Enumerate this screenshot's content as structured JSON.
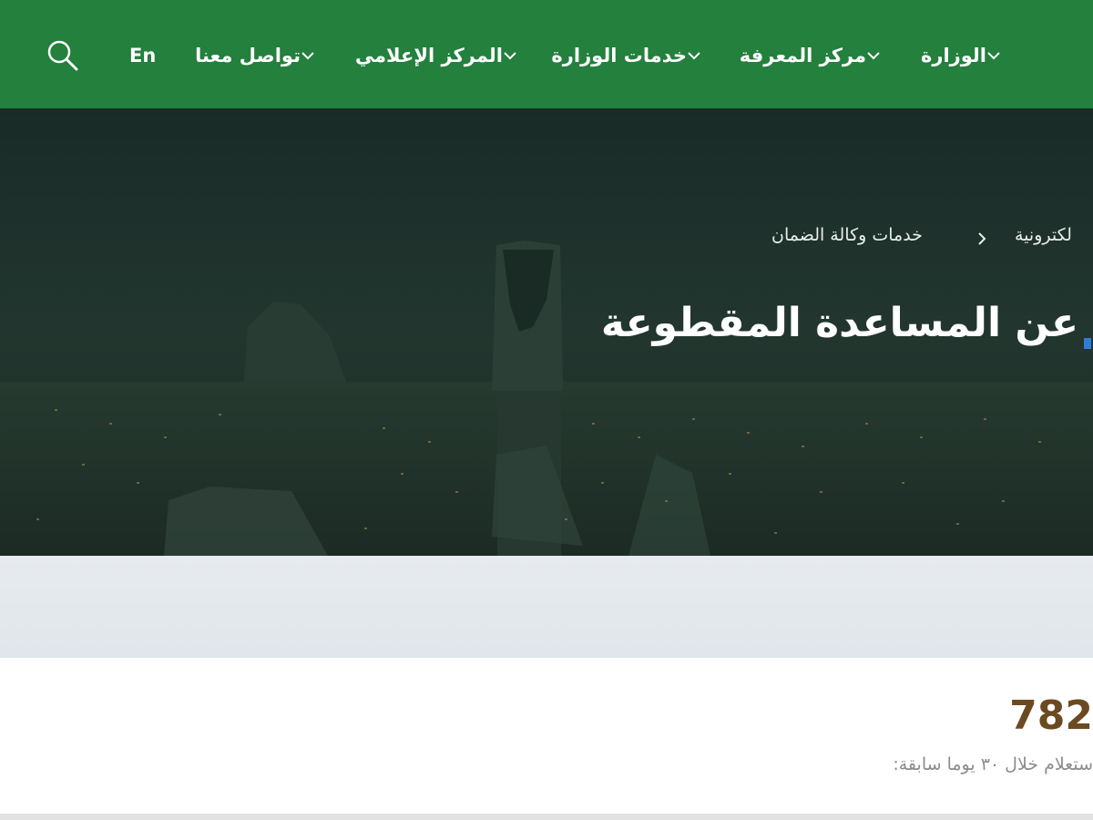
{
  "nav": {
    "items": [
      {
        "label": "الوزارة"
      },
      {
        "label": "مركز المعرفة"
      },
      {
        "label": "خدمات الوزارة"
      },
      {
        "label": "المركز الإعلامي"
      },
      {
        "label": "تواصل معنا"
      }
    ],
    "lang_label": "En",
    "search_icon": "search-icon"
  },
  "breadcrumb": {
    "first": "لكترونية",
    "second": "خدمات وكالة الضمان"
  },
  "hero": {
    "title": "عن المساعدة المقطوعة"
  },
  "stats": {
    "number": "782",
    "description": "ستعلام خلال ٣٠ يوما سابقة:"
  },
  "colors": {
    "nav_bg": "#23803d",
    "stat_number": "#6b4a22",
    "hero_overlay": "#1e3430"
  }
}
